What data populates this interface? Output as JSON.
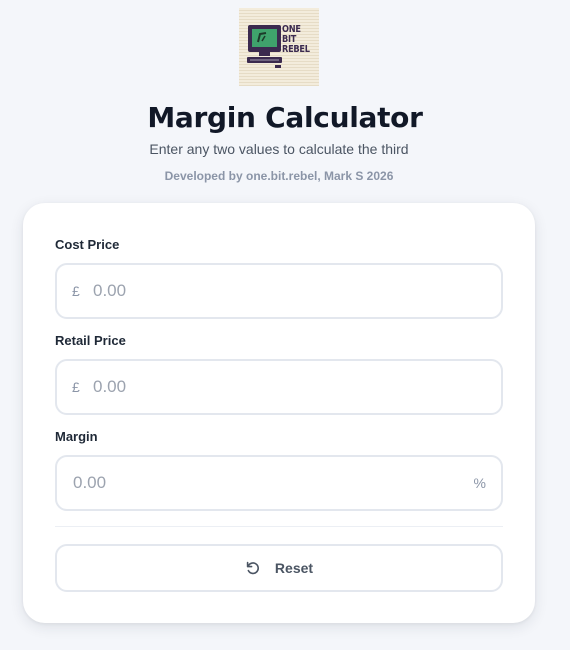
{
  "header": {
    "logo": {
      "icon": "retro-computer-logo",
      "text_lines": [
        "ONE",
        "BIT",
        "REBEL"
      ]
    },
    "title": "Margin Calculator",
    "subtitle": "Enter any two values to calculate the third",
    "credit": "Developed by one.bit.rebel, Mark S 2026"
  },
  "form": {
    "cost_price": {
      "label": "Cost Price",
      "prefix": "£",
      "value": "",
      "placeholder": "0.00"
    },
    "retail_price": {
      "label": "Retail Price",
      "prefix": "£",
      "value": "",
      "placeholder": "0.00"
    },
    "margin": {
      "label": "Margin",
      "suffix": "%",
      "value": "",
      "placeholder": "0.00"
    },
    "reset": {
      "label": "Reset",
      "icon": "reset-icon"
    }
  },
  "colors": {
    "page_background": "#f4f6fa",
    "card_background": "#ffffff",
    "title": "#111827",
    "muted_text": "#8b95a7",
    "field_border": "#e3e7ee",
    "logo_screen": "#3fa36c"
  }
}
